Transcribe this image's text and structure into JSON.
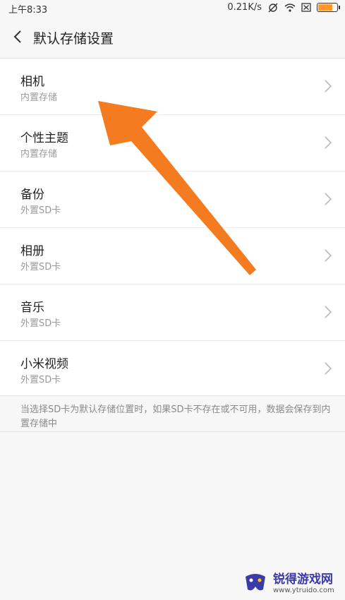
{
  "status_bar": {
    "time": "上午8:33",
    "speed": "0.21K/s"
  },
  "header": {
    "title": "默认存储设置"
  },
  "items": [
    {
      "label": "相机",
      "value": "内置存储"
    },
    {
      "label": "个性主题",
      "value": "内置存储"
    },
    {
      "label": "备份",
      "value": "外置SD卡"
    },
    {
      "label": "相册",
      "value": "外置SD卡"
    },
    {
      "label": "音乐",
      "value": "外置SD卡"
    },
    {
      "label": "小米视频",
      "value": "外置SD卡"
    }
  ],
  "footer_note": "当选择SD卡为默认存储位置时，如果SD卡不存在或不可用，数据会保存到内置存储中",
  "watermark": {
    "name": "锐得游戏网",
    "url": "www.ytruido.com"
  },
  "colors": {
    "arrow": "#f47b20",
    "battery": "#ff9a2a"
  }
}
